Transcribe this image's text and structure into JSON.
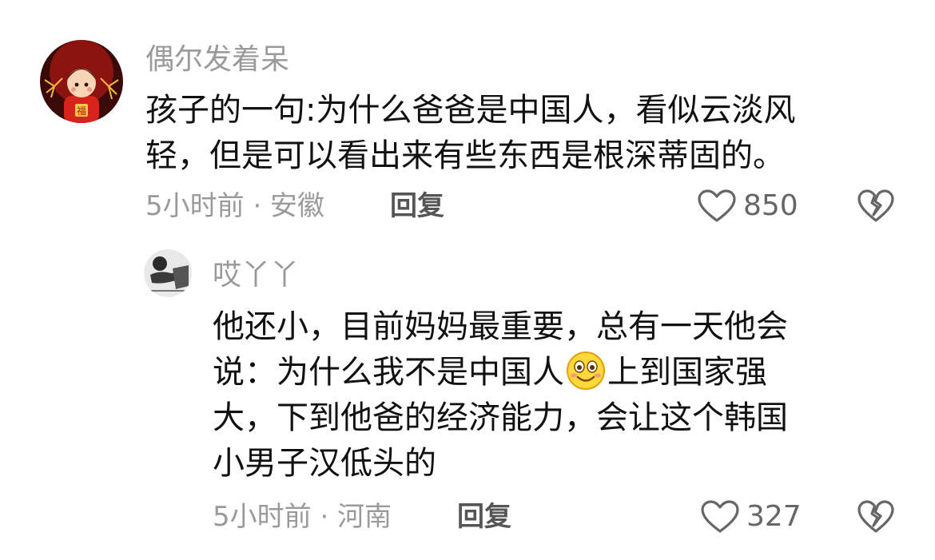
{
  "comments": [
    {
      "username": "偶尔发着呆",
      "text_line1": "孩子的一句:为什么爸爸是中国人，看似云淡风",
      "text_line2": "轻，但是可以看出来有些东西是根深蒂固的。",
      "meta": "5小时前 · 安徽",
      "reply_label": "回复",
      "like_count": "850",
      "avatar_seal": "福"
    },
    {
      "username": "哎丫丫",
      "text_line1": "他还小，目前妈妈最重要，总有一天他会",
      "text_line2_pre": "说：为什么我不是中国人",
      "text_line2_post": "上到国家强",
      "text_line3": "大，下到他爸的经济能力，会让这个韩国",
      "text_line4": "小男子汉低头的",
      "meta": "5小时前 · 河南",
      "reply_label": "回复",
      "like_count": "327"
    }
  ],
  "icons": {
    "like": "heart-outline-icon",
    "dislike": "broken-heart-icon",
    "emoji": "smiling-face-emoji"
  },
  "colors": {
    "username": "#9a9a9a",
    "body_text": "#111111",
    "meta": "#9a9a9a",
    "reply": "#555555",
    "icon_stroke": "#666666"
  }
}
